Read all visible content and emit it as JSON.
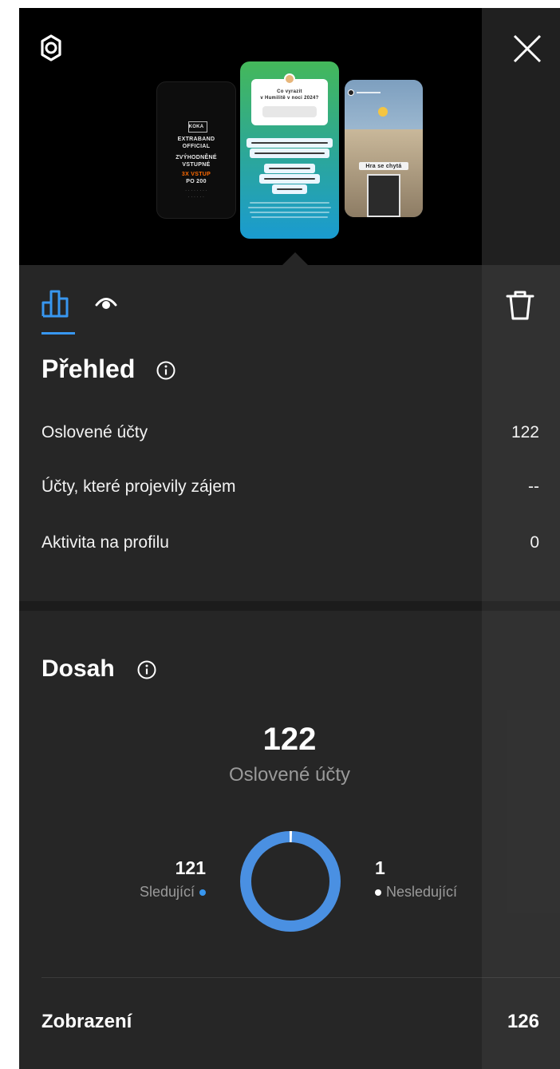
{
  "colors": {
    "accent": "#3897f0",
    "background": "#262626",
    "preview_background": "#000000",
    "muted_text": "#9a9a9a"
  },
  "icons": {
    "settings": "gear-icon",
    "close": "close-icon",
    "insights_tab": "bar-chart-icon",
    "views_tab": "eye-icon",
    "delete": "trash-icon",
    "info": "info-icon"
  },
  "preview": {
    "left_card": {
      "logo": "KOKA",
      "lines": [
        "EXTRABAND",
        "OFFICIAL",
        "ZVÝHODNĚNÉ",
        "VSTUPNÉ"
      ],
      "highlight": [
        "3X VSTUP",
        "PO 200"
      ]
    },
    "middle_card": {
      "question_lines": [
        "Co vyrazit",
        "v Humilitě v noci 2024?"
      ]
    },
    "right_card": {
      "caption": "Hra se chytá"
    }
  },
  "overview": {
    "title": "Přehled",
    "rows": [
      {
        "label": "Oslovené účty",
        "value": "122"
      },
      {
        "label": "Účty, které projevily zájem",
        "value": "--"
      },
      {
        "label": "Aktivita na profilu",
        "value": "0"
      }
    ]
  },
  "reach": {
    "title": "Dosah",
    "total": "122",
    "total_label": "Oslovené účty",
    "followers_value": "121",
    "followers_label": "Sledující",
    "non_followers_value": "1",
    "non_followers_label": "Nesledující",
    "followers_fraction": 0.9918
  },
  "impressions": {
    "label": "Zobrazení",
    "value": "126"
  }
}
